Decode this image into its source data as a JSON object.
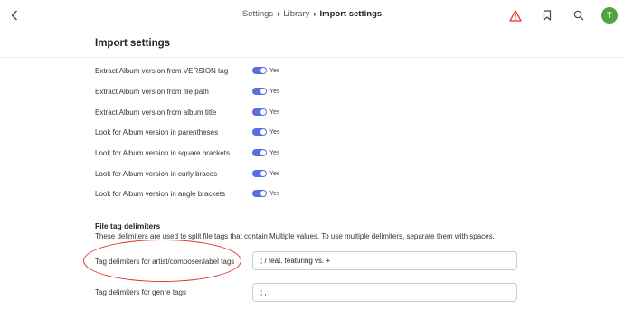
{
  "header": {
    "breadcrumbs": [
      "Settings",
      "Library"
    ],
    "current": "Import settings",
    "avatar_initial": "T",
    "icons": [
      "chevron-left-icon",
      "chevron-right-icon",
      "warning-icon",
      "bookmark-icon",
      "search-icon"
    ],
    "colors": {
      "warning": "#e03131",
      "avatar": "#52a33f",
      "toggle": "#5b6ee1"
    }
  },
  "page": {
    "title": "Import settings"
  },
  "album_settings": [
    {
      "label": "Extract Album version from VERSION tag",
      "value": "Yes"
    },
    {
      "label": "Extract Album version from file path",
      "value": "Yes"
    },
    {
      "label": "Extract Album version from album title",
      "value": "Yes"
    },
    {
      "label": "Look for Album version in parentheses",
      "value": "Yes"
    },
    {
      "label": "Look for Album version in square brackets",
      "value": "Yes"
    },
    {
      "label": "Look for Album version in curly braces",
      "value": "Yes"
    },
    {
      "label": "Look for Album version in angle brackets",
      "value": "Yes"
    }
  ],
  "delimiters": {
    "title": "File tag delimiters",
    "description": "These delimiters are used to split file tags that contain Multiple values. To use multiple delimiters, separate them with spaces.",
    "fields": [
      {
        "label": "Tag delimiters for artist/composer/label tags",
        "value": "; / feat. featuring vs. +"
      },
      {
        "label": "Tag delimiters for genre tags",
        "value": "; ,"
      }
    ]
  }
}
